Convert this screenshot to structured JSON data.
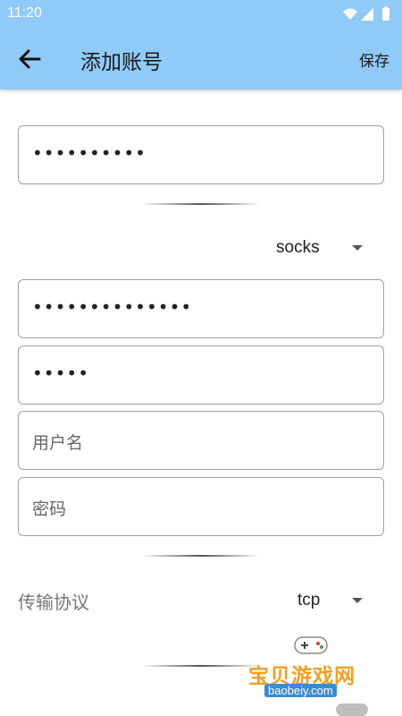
{
  "status_bar": {
    "time": "11:20"
  },
  "app_bar": {
    "title": "添加账号",
    "save_label": "保存"
  },
  "form": {
    "field_1": {
      "value": "••••••••••"
    },
    "proxy_type": {
      "selected": "socks"
    },
    "field_2": {
      "value": "••••••••••••••"
    },
    "field_3": {
      "value": "•••••"
    },
    "username": {
      "placeholder": "用户名"
    },
    "password": {
      "placeholder": "密码"
    },
    "protocol": {
      "label": "传输协议",
      "selected": "tcp"
    }
  },
  "watermark": {
    "name": "宝贝游戏网",
    "url": "baobeiy.com"
  },
  "colors": {
    "app_bar": "#90caf9",
    "border": "#9e9e9e"
  }
}
